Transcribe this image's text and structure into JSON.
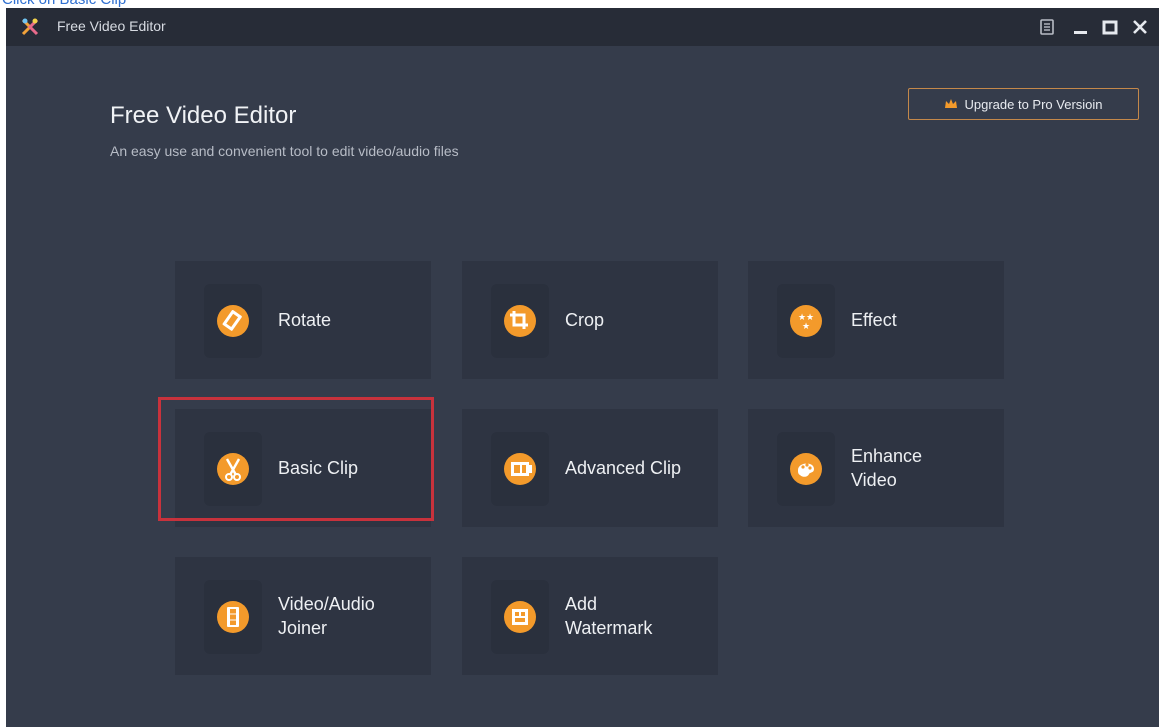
{
  "caption": "Click on Basic Clip",
  "window": {
    "title": "Free Video Editor",
    "controls": [
      "settings-icon",
      "minimize-icon",
      "maximize-icon",
      "close-icon"
    ]
  },
  "hero": {
    "title": "Free Video Editor",
    "subtitle": "An easy use and convenient tool to edit video/audio files"
  },
  "upgrade": {
    "label": "Upgrade to Pro Versioin",
    "icon": "crown-icon"
  },
  "tools": [
    {
      "label": "Rotate",
      "icon": "rotate-icon"
    },
    {
      "label": "Crop",
      "icon": "crop-icon"
    },
    {
      "label": "Effect",
      "icon": "effect-icon"
    },
    {
      "label": "Basic Clip",
      "icon": "scissors-icon"
    },
    {
      "label": "Advanced Clip",
      "icon": "film-icon"
    },
    {
      "label": "Enhance\nVideo",
      "icon": "palette-icon"
    },
    {
      "label": "Video/Audio\nJoiner",
      "icon": "joiner-icon"
    },
    {
      "label": "Add\nWatermark",
      "icon": "watermark-icon"
    }
  ],
  "colors": {
    "window_bg": "#353c4b",
    "titlebar_bg": "#272c37",
    "tile_bg": "#2e3442",
    "accent_orange": "#f39a2b",
    "highlight_red": "#c8323c"
  },
  "highlighted_tool": "Basic Clip"
}
